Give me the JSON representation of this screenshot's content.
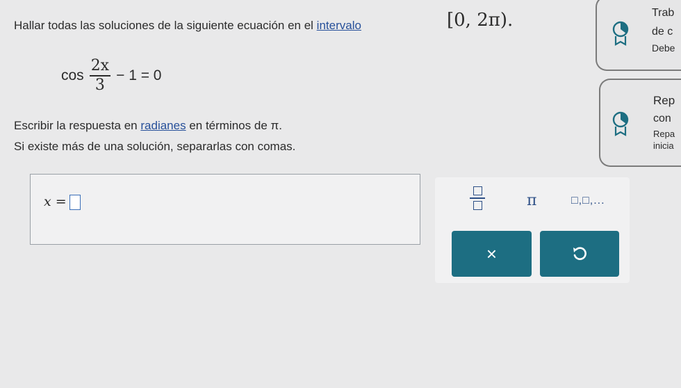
{
  "question": {
    "prefix": "Hallar todas las soluciones de la siguiente ecuación en el ",
    "link": "intervalo",
    "interval": "[0, 2π)",
    "period": "."
  },
  "equation": {
    "func": "cos",
    "numerator": "2x",
    "denominator": "3",
    "rest": "− 1 = 0"
  },
  "instructions": {
    "line1_prefix": "Escribir la respuesta en ",
    "line1_link": "radianes",
    "line1_suffix": " en términos de π.",
    "line2": "Si existe más de una solución, separarlas con comas."
  },
  "answer": {
    "label": "x =",
    "value": ""
  },
  "keypad": {
    "pi": "π",
    "list": "□,□,...",
    "clear": "×",
    "undo_icon": "undo-icon"
  },
  "sidebar": {
    "card1": {
      "line1": "Trab",
      "line2": "de c",
      "line3": "Debe"
    },
    "card2": {
      "line1": "Rep",
      "line2": "con",
      "line3": "Repa",
      "line4": "inicia"
    }
  },
  "colors": {
    "background": "#e9e9ea",
    "button": "#1d6e82",
    "link": "#27509a",
    "keypad_symbol": "#2d4f86"
  }
}
